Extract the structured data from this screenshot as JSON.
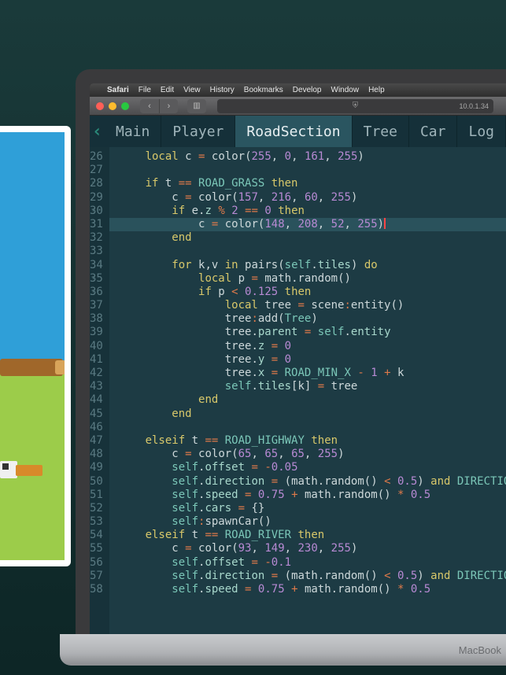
{
  "menubar": {
    "apple": "",
    "app": "Safari",
    "items": [
      "File",
      "Edit",
      "View",
      "History",
      "Bookmarks",
      "Develop",
      "Window",
      "Help"
    ]
  },
  "toolbar": {
    "back_glyph": "‹",
    "fwd_glyph": "›",
    "sidebar_glyph": "▥",
    "shield_glyph": "⛨",
    "address": "10.0.1.34"
  },
  "editor": {
    "back_chevron": "‹",
    "tabs": [
      {
        "label": "Main",
        "active": false
      },
      {
        "label": "Player",
        "active": false
      },
      {
        "label": "RoadSection",
        "active": true
      },
      {
        "label": "Tree",
        "active": false
      },
      {
        "label": "Car",
        "active": false
      },
      {
        "label": "Log",
        "active": false
      }
    ],
    "first_line_no": 26,
    "fold_lines": [
      28,
      30,
      35,
      36
    ],
    "highlight_line": 31,
    "lines": [
      [
        [
          "",
          "    "
        ],
        [
          "kw",
          "local"
        ],
        [
          "",
          " c "
        ],
        [
          "op",
          "="
        ],
        [
          "",
          " "
        ],
        [
          "call",
          "color"
        ],
        [
          "paren",
          "("
        ],
        [
          "num",
          "255"
        ],
        [
          "",
          ", "
        ],
        [
          "num",
          "0"
        ],
        [
          "",
          ", "
        ],
        [
          "num",
          "161"
        ],
        [
          "",
          ", "
        ],
        [
          "num",
          "255"
        ],
        [
          "paren",
          ")"
        ]
      ],
      [],
      [
        [
          "",
          "    "
        ],
        [
          "kw",
          "if"
        ],
        [
          "",
          " t "
        ],
        [
          "op",
          "=="
        ],
        [
          "",
          " "
        ],
        [
          "const",
          "ROAD_GRASS"
        ],
        [
          "",
          " "
        ],
        [
          "kw",
          "then"
        ]
      ],
      [
        [
          "",
          "        c "
        ],
        [
          "op",
          "="
        ],
        [
          "",
          " "
        ],
        [
          "call",
          "color"
        ],
        [
          "paren",
          "("
        ],
        [
          "num",
          "157"
        ],
        [
          "",
          ", "
        ],
        [
          "num",
          "216"
        ],
        [
          "",
          ", "
        ],
        [
          "num",
          "60"
        ],
        [
          "",
          ", "
        ],
        [
          "num",
          "255"
        ],
        [
          "paren",
          ")"
        ]
      ],
      [
        [
          "",
          "        "
        ],
        [
          "kw",
          "if"
        ],
        [
          "",
          " e"
        ],
        [
          "dot",
          "."
        ],
        [
          "prop",
          "z"
        ],
        [
          "",
          " "
        ],
        [
          "op",
          "%"
        ],
        [
          "",
          " "
        ],
        [
          "num",
          "2"
        ],
        [
          "",
          " "
        ],
        [
          "op",
          "=="
        ],
        [
          "",
          " "
        ],
        [
          "num",
          "0"
        ],
        [
          "",
          " "
        ],
        [
          "kw",
          "then"
        ]
      ],
      [
        [
          "",
          "            c "
        ],
        [
          "op",
          "="
        ],
        [
          "",
          " "
        ],
        [
          "call",
          "color"
        ],
        [
          "paren",
          "("
        ],
        [
          "num",
          "148"
        ],
        [
          "",
          ", "
        ],
        [
          "num",
          "208"
        ],
        [
          "",
          ", "
        ],
        [
          "num",
          "52"
        ],
        [
          "",
          ", "
        ],
        [
          "num",
          "255"
        ],
        [
          "paren",
          ")"
        ],
        [
          "cursor",
          ""
        ]
      ],
      [
        [
          "",
          "        "
        ],
        [
          "kw",
          "end"
        ]
      ],
      [],
      [
        [
          "",
          "        "
        ],
        [
          "kw",
          "for"
        ],
        [
          "",
          " k,v "
        ],
        [
          "kw",
          "in"
        ],
        [
          "",
          " "
        ],
        [
          "call",
          "pairs"
        ],
        [
          "paren",
          "("
        ],
        [
          "self",
          "self"
        ],
        [
          "dot",
          "."
        ],
        [
          "prop",
          "tiles"
        ],
        [
          "paren",
          ")"
        ],
        [
          "",
          " "
        ],
        [
          "kw",
          "do"
        ]
      ],
      [
        [
          "",
          "            "
        ],
        [
          "kw",
          "local"
        ],
        [
          "",
          " p "
        ],
        [
          "op",
          "="
        ],
        [
          "",
          " math"
        ],
        [
          "dot",
          "."
        ],
        [
          "call",
          "random"
        ],
        [
          "paren",
          "()"
        ]
      ],
      [
        [
          "",
          "            "
        ],
        [
          "kw",
          "if"
        ],
        [
          "",
          " p "
        ],
        [
          "op",
          "<"
        ],
        [
          "",
          " "
        ],
        [
          "num",
          "0.125"
        ],
        [
          "",
          " "
        ],
        [
          "kw",
          "then"
        ]
      ],
      [
        [
          "",
          "                "
        ],
        [
          "kw",
          "local"
        ],
        [
          "",
          " tree "
        ],
        [
          "op",
          "="
        ],
        [
          "",
          " scene"
        ],
        [
          "op",
          ":"
        ],
        [
          "call",
          "entity"
        ],
        [
          "paren",
          "()"
        ]
      ],
      [
        [
          "",
          "                tree"
        ],
        [
          "op",
          ":"
        ],
        [
          "call",
          "add"
        ],
        [
          "paren",
          "("
        ],
        [
          "const",
          "Tree"
        ],
        [
          "paren",
          ")"
        ]
      ],
      [
        [
          "",
          "                tree"
        ],
        [
          "dot",
          "."
        ],
        [
          "prop",
          "parent"
        ],
        [
          "",
          " "
        ],
        [
          "op",
          "="
        ],
        [
          "",
          " "
        ],
        [
          "self",
          "self"
        ],
        [
          "dot",
          "."
        ],
        [
          "prop",
          "entity"
        ]
      ],
      [
        [
          "",
          "                tree"
        ],
        [
          "dot",
          "."
        ],
        [
          "prop",
          "z"
        ],
        [
          "",
          " "
        ],
        [
          "op",
          "="
        ],
        [
          "",
          " "
        ],
        [
          "num",
          "0"
        ]
      ],
      [
        [
          "",
          "                tree"
        ],
        [
          "dot",
          "."
        ],
        [
          "prop",
          "y"
        ],
        [
          "",
          " "
        ],
        [
          "op",
          "="
        ],
        [
          "",
          " "
        ],
        [
          "num",
          "0"
        ]
      ],
      [
        [
          "",
          "                tree"
        ],
        [
          "dot",
          "."
        ],
        [
          "prop",
          "x"
        ],
        [
          "",
          " "
        ],
        [
          "op",
          "="
        ],
        [
          "",
          " "
        ],
        [
          "const",
          "ROAD_MIN_X"
        ],
        [
          "",
          " "
        ],
        [
          "op",
          "-"
        ],
        [
          "",
          " "
        ],
        [
          "num",
          "1"
        ],
        [
          "",
          " "
        ],
        [
          "op",
          "+"
        ],
        [
          "",
          " k"
        ]
      ],
      [
        [
          "",
          "                "
        ],
        [
          "self",
          "self"
        ],
        [
          "dot",
          "."
        ],
        [
          "prop",
          "tiles"
        ],
        [
          "paren",
          "["
        ],
        [
          "",
          "k"
        ],
        [
          "paren",
          "]"
        ],
        [
          "",
          " "
        ],
        [
          "op",
          "="
        ],
        [
          "",
          " tree"
        ]
      ],
      [
        [
          "",
          "            "
        ],
        [
          "kw",
          "end"
        ]
      ],
      [
        [
          "",
          "        "
        ],
        [
          "kw",
          "end"
        ]
      ],
      [],
      [
        [
          "",
          "    "
        ],
        [
          "kw",
          "elseif"
        ],
        [
          "",
          " t "
        ],
        [
          "op",
          "=="
        ],
        [
          "",
          " "
        ],
        [
          "const",
          "ROAD_HIGHWAY"
        ],
        [
          "",
          " "
        ],
        [
          "kw",
          "then"
        ]
      ],
      [
        [
          "",
          "        c "
        ],
        [
          "op",
          "="
        ],
        [
          "",
          " "
        ],
        [
          "call",
          "color"
        ],
        [
          "paren",
          "("
        ],
        [
          "num",
          "65"
        ],
        [
          "",
          ", "
        ],
        [
          "num",
          "65"
        ],
        [
          "",
          ", "
        ],
        [
          "num",
          "65"
        ],
        [
          "",
          ", "
        ],
        [
          "num",
          "255"
        ],
        [
          "paren",
          ")"
        ]
      ],
      [
        [
          "",
          "        "
        ],
        [
          "self",
          "self"
        ],
        [
          "dot",
          "."
        ],
        [
          "prop",
          "offset"
        ],
        [
          "",
          " "
        ],
        [
          "op",
          "="
        ],
        [
          "",
          " "
        ],
        [
          "op",
          "-"
        ],
        [
          "num",
          "0.05"
        ]
      ],
      [
        [
          "",
          "        "
        ],
        [
          "self",
          "self"
        ],
        [
          "dot",
          "."
        ],
        [
          "prop",
          "direction"
        ],
        [
          "",
          " "
        ],
        [
          "op",
          "="
        ],
        [
          "",
          " "
        ],
        [
          "paren",
          "("
        ],
        [
          "",
          "math"
        ],
        [
          "dot",
          "."
        ],
        [
          "call",
          "random"
        ],
        [
          "paren",
          "()"
        ],
        [
          "",
          " "
        ],
        [
          "op",
          "<"
        ],
        [
          "",
          " "
        ],
        [
          "num",
          "0.5"
        ],
        [
          "paren",
          ")"
        ],
        [
          "",
          " "
        ],
        [
          "kw",
          "and"
        ],
        [
          "",
          " "
        ],
        [
          "const",
          "DIRECTION_"
        ]
      ],
      [
        [
          "",
          "        "
        ],
        [
          "self",
          "self"
        ],
        [
          "dot",
          "."
        ],
        [
          "prop",
          "speed"
        ],
        [
          "",
          " "
        ],
        [
          "op",
          "="
        ],
        [
          "",
          " "
        ],
        [
          "num",
          "0.75"
        ],
        [
          "",
          " "
        ],
        [
          "op",
          "+"
        ],
        [
          "",
          " math"
        ],
        [
          "dot",
          "."
        ],
        [
          "call",
          "random"
        ],
        [
          "paren",
          "()"
        ],
        [
          "",
          " "
        ],
        [
          "op",
          "*"
        ],
        [
          "",
          " "
        ],
        [
          "num",
          "0.5"
        ]
      ],
      [
        [
          "",
          "        "
        ],
        [
          "self",
          "self"
        ],
        [
          "dot",
          "."
        ],
        [
          "prop",
          "cars"
        ],
        [
          "",
          " "
        ],
        [
          "op",
          "="
        ],
        [
          "",
          " "
        ],
        [
          "paren",
          "{}"
        ]
      ],
      [
        [
          "",
          "        "
        ],
        [
          "self",
          "self"
        ],
        [
          "op",
          ":"
        ],
        [
          "call",
          "spawnCar"
        ],
        [
          "paren",
          "()"
        ]
      ],
      [
        [
          "",
          "    "
        ],
        [
          "kw",
          "elseif"
        ],
        [
          "",
          " t "
        ],
        [
          "op",
          "=="
        ],
        [
          "",
          " "
        ],
        [
          "const",
          "ROAD_RIVER"
        ],
        [
          "",
          " "
        ],
        [
          "kw",
          "then"
        ]
      ],
      [
        [
          "",
          "        c "
        ],
        [
          "op",
          "="
        ],
        [
          "",
          " "
        ],
        [
          "call",
          "color"
        ],
        [
          "paren",
          "("
        ],
        [
          "num",
          "93"
        ],
        [
          "",
          ", "
        ],
        [
          "num",
          "149"
        ],
        [
          "",
          ", "
        ],
        [
          "num",
          "230"
        ],
        [
          "",
          ", "
        ],
        [
          "num",
          "255"
        ],
        [
          "paren",
          ")"
        ]
      ],
      [
        [
          "",
          "        "
        ],
        [
          "self",
          "self"
        ],
        [
          "dot",
          "."
        ],
        [
          "prop",
          "offset"
        ],
        [
          "",
          " "
        ],
        [
          "op",
          "="
        ],
        [
          "",
          " "
        ],
        [
          "op",
          "-"
        ],
        [
          "num",
          "0.1"
        ]
      ],
      [
        [
          "",
          "        "
        ],
        [
          "self",
          "self"
        ],
        [
          "dot",
          "."
        ],
        [
          "prop",
          "direction"
        ],
        [
          "",
          " "
        ],
        [
          "op",
          "="
        ],
        [
          "",
          " "
        ],
        [
          "paren",
          "("
        ],
        [
          "",
          "math"
        ],
        [
          "dot",
          "."
        ],
        [
          "call",
          "random"
        ],
        [
          "paren",
          "()"
        ],
        [
          "",
          " "
        ],
        [
          "op",
          "<"
        ],
        [
          "",
          " "
        ],
        [
          "num",
          "0.5"
        ],
        [
          "paren",
          ")"
        ],
        [
          "",
          " "
        ],
        [
          "kw",
          "and"
        ],
        [
          "",
          " "
        ],
        [
          "const",
          "DIRECTION_"
        ]
      ],
      [
        [
          "",
          "        "
        ],
        [
          "self",
          "self"
        ],
        [
          "dot",
          "."
        ],
        [
          "prop",
          "speed"
        ],
        [
          "",
          " "
        ],
        [
          "op",
          "="
        ],
        [
          "",
          " "
        ],
        [
          "num",
          "0.75"
        ],
        [
          "",
          " "
        ],
        [
          "op",
          "+"
        ],
        [
          "",
          " math"
        ],
        [
          "dot",
          "."
        ],
        [
          "call",
          "random"
        ],
        [
          "paren",
          "()"
        ],
        [
          "",
          " "
        ],
        [
          "op",
          "*"
        ],
        [
          "",
          " "
        ],
        [
          "num",
          "0.5"
        ]
      ]
    ]
  },
  "macbook_label": "MacBook"
}
